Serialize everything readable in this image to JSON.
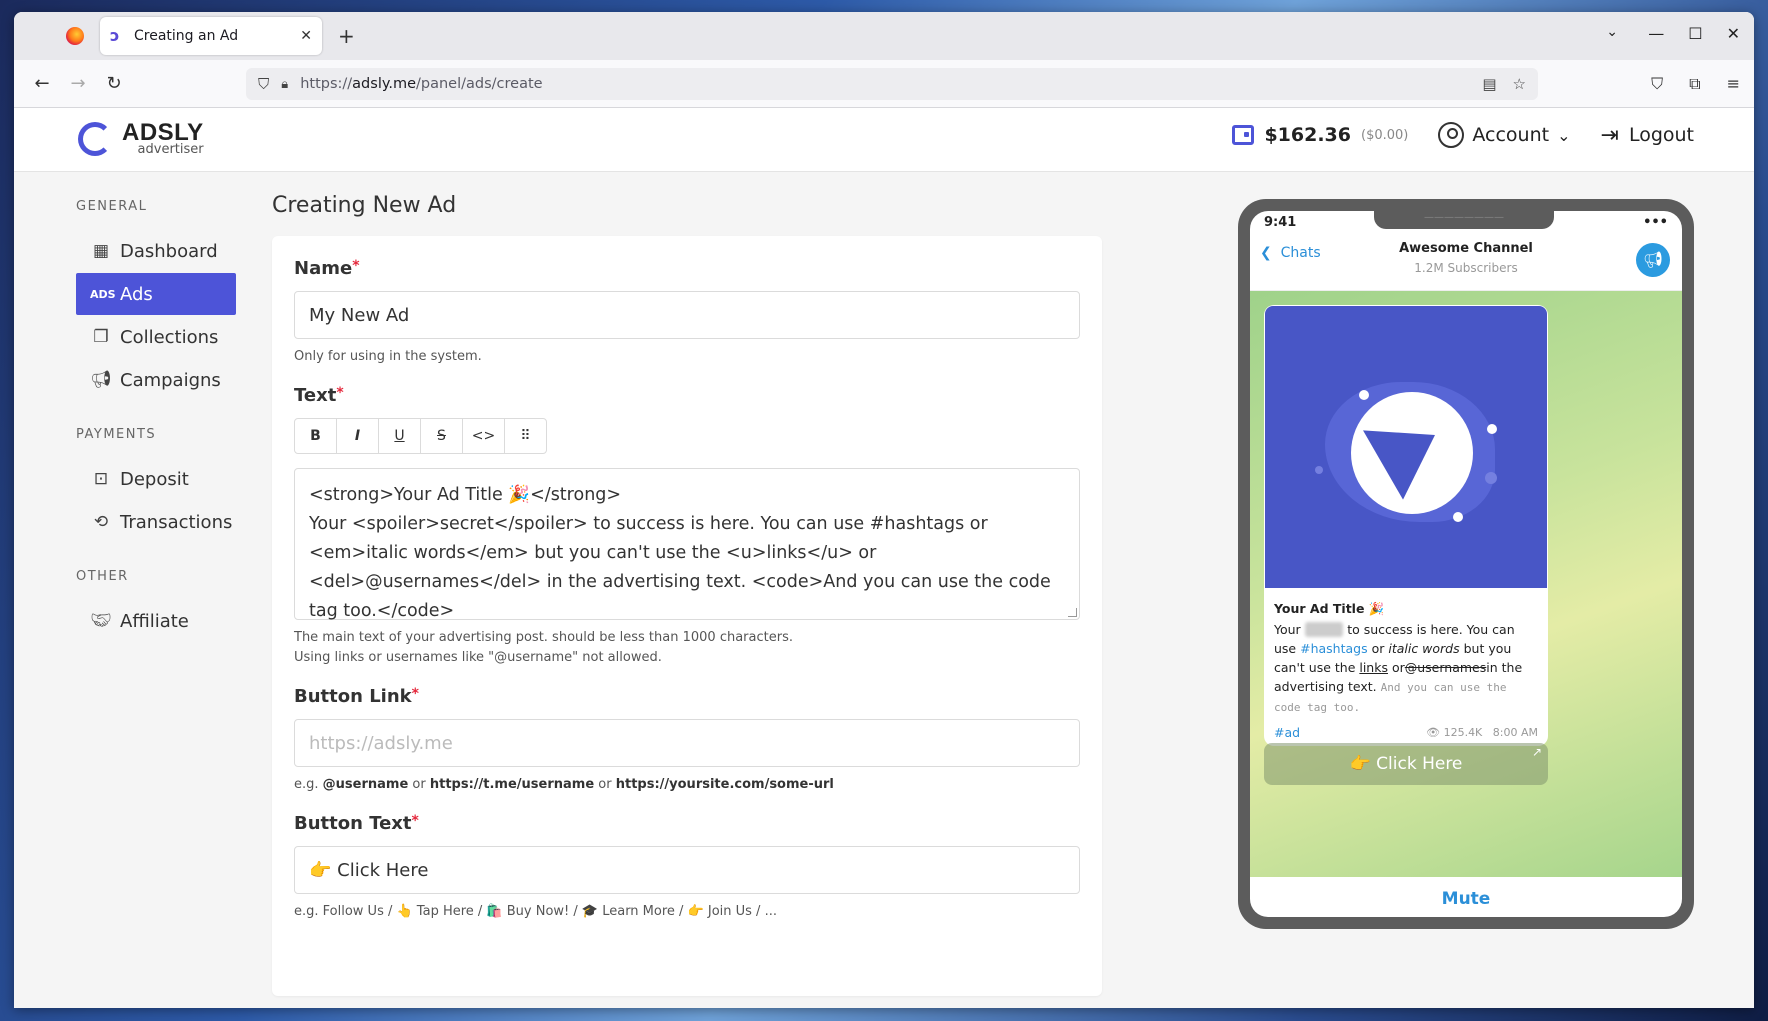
{
  "browser": {
    "tab_title": "Creating an Ad",
    "url_prefix": "https://",
    "url_domain": "adsly.me",
    "url_path": "/panel/ads/create"
  },
  "header": {
    "brand_name": "ADSLY",
    "brand_sub": "advertiser",
    "balance": "$162.36",
    "balance_pending": "($0.00)",
    "account_label": "Account",
    "logout_label": "Logout"
  },
  "sidebar": {
    "general_label": "GENERAL",
    "payments_label": "PAYMENTS",
    "other_label": "OTHER",
    "items": [
      {
        "label": "Dashboard",
        "icon": "dashboard-icon"
      },
      {
        "label": "Ads",
        "icon": "ads-icon"
      },
      {
        "label": "Collections",
        "icon": "collections-icon"
      },
      {
        "label": "Campaigns",
        "icon": "megaphone-icon"
      },
      {
        "label": "Deposit",
        "icon": "wallet-icon"
      },
      {
        "label": "Transactions",
        "icon": "history-icon"
      },
      {
        "label": "Affiliate",
        "icon": "handshake-icon"
      }
    ],
    "active": "Ads"
  },
  "form": {
    "page_title": "Creating New Ad",
    "name_label": "Name",
    "name_value": "My New Ad",
    "name_help": "Only for using in the system.",
    "text_label": "Text",
    "toolbar": [
      "B",
      "I",
      "U",
      "S",
      "<>",
      "⠿"
    ],
    "text_value": "<strong>Your Ad Title 🎉</strong>\nYour <spoiler>secret</spoiler> to success is here. You can use #hashtags or <em>italic words</em> but you can't use the <u>links</u> or <del>@usernames</del> in the advertising text. <code>And you can use the code tag too.</code>",
    "text_help_1": "The main text of your advertising post. should be less than 1000 characters.",
    "text_help_2": "Using links or usernames like \"@username\" not allowed.",
    "link_label": "Button Link",
    "link_placeholder": "https://adsly.me",
    "link_help_prefix": "e.g. ",
    "link_help_ex1": "@username",
    "link_help_or1": " or ",
    "link_help_ex2": "https://t.me/username",
    "link_help_or2": " or ",
    "link_help_ex3": "https://yoursite.com/some-url",
    "btntext_label": "Button Text",
    "btntext_value": "👉 Click Here",
    "btntext_help": "e.g. Follow Us / 👆 Tap Here / 🛍️ Buy Now! / 🎓 Learn More / 👉 Join Us / ..."
  },
  "preview": {
    "time": "9:41",
    "dots": "•••",
    "notch": "————————",
    "back_label": "Chats",
    "channel_name": "Awesome Channel",
    "subscribers": "1.2M Subscribers",
    "msg_title": "Your Ad Title 🎉",
    "msg_part1": "Your ",
    "msg_spoiler": "secret",
    "msg_part2": " to success is here. You can use ",
    "msg_hashtag": "#hashtags",
    "msg_part3": " or ",
    "msg_italic": "italic words",
    "msg_part4": " but you can't use the ",
    "msg_link": "links",
    "msg_part5": " or",
    "msg_del": "@usernames",
    "msg_part6": "in the advertising text. ",
    "msg_code": "And you can use the code tag too.",
    "tag": "#ad",
    "views": "👁 125.4K",
    "time_sent": "8:00 AM",
    "button_label": "👉 Click Here",
    "mute_label": "Mute"
  }
}
